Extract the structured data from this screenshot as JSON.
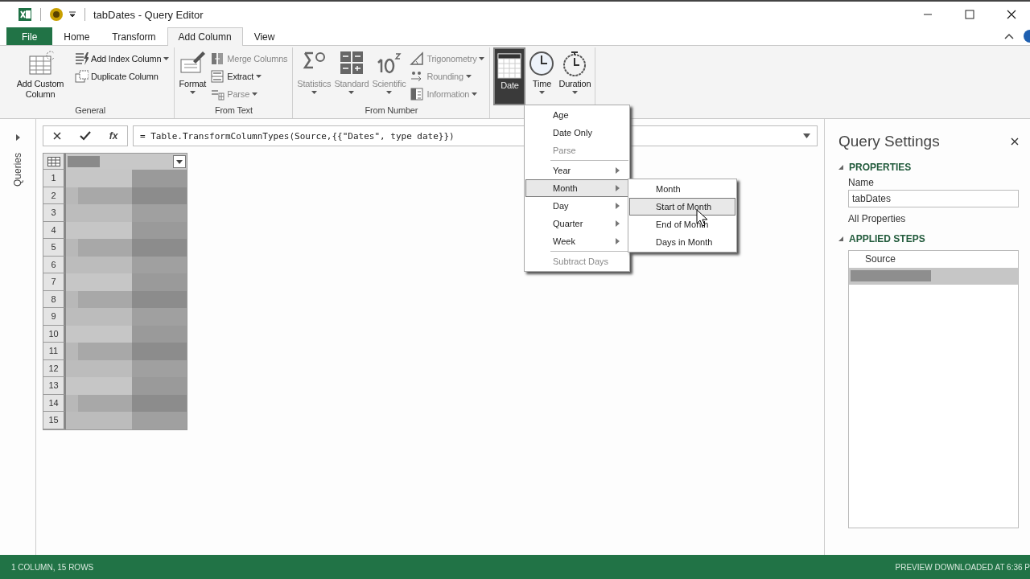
{
  "window": {
    "title": "tabDates - Query Editor"
  },
  "ribbon_tabs": [
    {
      "label": "File",
      "kind": "file",
      "selected": false
    },
    {
      "label": "Home",
      "kind": "tab",
      "selected": false
    },
    {
      "label": "Transform",
      "kind": "tab",
      "selected": false
    },
    {
      "label": "Add Column",
      "kind": "tab",
      "selected": true
    },
    {
      "label": "View",
      "kind": "tab",
      "selected": false
    }
  ],
  "ribbon": {
    "groups": [
      {
        "label": "General",
        "items": [
          {
            "kind": "large",
            "label": "Add Custom Column",
            "dropdown": false,
            "disabled": false
          },
          {
            "kind": "small",
            "label": "Add Index Column",
            "dropdown": true,
            "disabled": false
          },
          {
            "kind": "small",
            "label": "Duplicate Column",
            "dropdown": false,
            "disabled": false
          }
        ]
      },
      {
        "label": "From Text",
        "items": [
          {
            "kind": "large",
            "label": "Format",
            "dropdown": true,
            "disabled": false
          },
          {
            "kind": "small",
            "label": "Merge Columns",
            "dropdown": false,
            "disabled": true
          },
          {
            "kind": "small",
            "label": "Extract",
            "dropdown": true,
            "disabled": false
          },
          {
            "kind": "small",
            "label": "Parse",
            "dropdown": true,
            "disabled": true
          }
        ]
      },
      {
        "label": "From Number",
        "items": [
          {
            "kind": "large",
            "label": "Statistics",
            "dropdown": true,
            "disabled": true
          },
          {
            "kind": "large",
            "label": "Standard",
            "dropdown": true,
            "disabled": true
          },
          {
            "kind": "large",
            "label": "Scientific",
            "dropdown": true,
            "disabled": true
          },
          {
            "kind": "small",
            "label": "Trigonometry",
            "dropdown": true,
            "disabled": true
          },
          {
            "kind": "small",
            "label": "Rounding",
            "dropdown": true,
            "disabled": true
          },
          {
            "kind": "small",
            "label": "Information",
            "dropdown": true,
            "disabled": true
          }
        ]
      },
      {
        "items": [
          {
            "kind": "large",
            "label": "Date",
            "dropdown": false,
            "disabled": false,
            "pressed": true
          },
          {
            "kind": "large",
            "label": "Time",
            "dropdown": true,
            "disabled": false,
            "pressed": false
          },
          {
            "kind": "large",
            "label": "Duration",
            "dropdown": true,
            "disabled": false,
            "pressed": false
          }
        ]
      }
    ]
  },
  "queries_pane": {
    "label": "Queries",
    "expanded": false
  },
  "formula_bar": {
    "fx": "fx",
    "formula": "= Table.TransformColumnTypes(Source,{{\"Dates\", type date}})"
  },
  "table": {
    "row_numbers": [
      "1",
      "2",
      "3",
      "4",
      "5",
      "6",
      "7",
      "8",
      "9",
      "10",
      "11",
      "12",
      "13",
      "14",
      "15"
    ]
  },
  "date_menu": {
    "items": [
      {
        "label": "Age",
        "submenu": false,
        "disabled": false,
        "selected": false,
        "separator_before": false
      },
      {
        "label": "Date Only",
        "submenu": false,
        "disabled": false,
        "selected": false,
        "separator_before": false
      },
      {
        "label": "Parse",
        "submenu": false,
        "disabled": true,
        "selected": false,
        "separator_before": false
      },
      {
        "label": "Year",
        "submenu": true,
        "disabled": false,
        "selected": false,
        "separator_before": true
      },
      {
        "label": "Month",
        "submenu": true,
        "disabled": false,
        "selected": true,
        "separator_before": false
      },
      {
        "label": "Day",
        "submenu": true,
        "disabled": false,
        "selected": false,
        "separator_before": false
      },
      {
        "label": "Quarter",
        "submenu": true,
        "disabled": false,
        "selected": false,
        "separator_before": false
      },
      {
        "label": "Week",
        "submenu": true,
        "disabled": false,
        "selected": false,
        "separator_before": false
      },
      {
        "label": "Subtract Days",
        "submenu": false,
        "disabled": true,
        "selected": false,
        "separator_before": true
      }
    ]
  },
  "month_submenu": {
    "items": [
      {
        "label": "Month",
        "selected": false
      },
      {
        "label": "Start of Month",
        "selected": true
      },
      {
        "label": "End of Month",
        "selected": false
      },
      {
        "label": "Days in Month",
        "selected": false
      }
    ]
  },
  "query_settings": {
    "title": "Query Settings",
    "properties": {
      "heading": "PROPERTIES",
      "expanded": true,
      "name_label": "Name",
      "name_value": "tabDates",
      "all_properties": "All Properties"
    },
    "applied_steps": {
      "heading": "APPLIED STEPS",
      "expanded": true,
      "steps": [
        {
          "label": "Source",
          "selected": false
        },
        {
          "selected": true
        }
      ]
    }
  },
  "status_bar": {
    "left": "1 COLUMN, 15 ROWS",
    "right": "PREVIEW DOWNLOADED AT 6:36 P"
  }
}
